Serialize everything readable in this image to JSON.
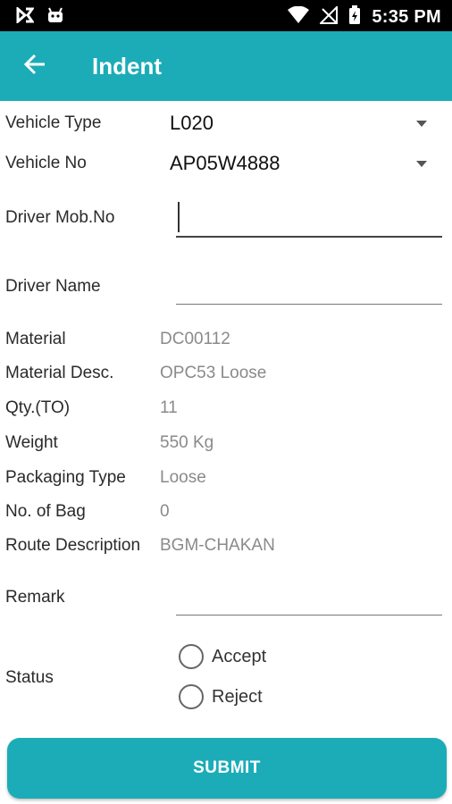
{
  "status_bar": {
    "time": "5:35 PM",
    "left_icons": [
      "notification-app-icon",
      "android-icon"
    ],
    "right_icons": [
      "wifi-icon",
      "no-signal-icon",
      "battery-charging-icon"
    ]
  },
  "app_bar": {
    "title": "Indent",
    "back_icon": "arrow-back-icon",
    "color": "#1bacb8"
  },
  "form": {
    "vehicle_type": {
      "label": "Vehicle Type",
      "value": "L020"
    },
    "vehicle_no": {
      "label": "Vehicle No",
      "value": "AP05W4888"
    },
    "driver_mob_no": {
      "label": "Driver Mob.No",
      "value": "",
      "placeholder": ""
    },
    "driver_name": {
      "label": "Driver Name",
      "value": "",
      "placeholder": ""
    },
    "details": [
      {
        "label": "Material",
        "value": "DC00112"
      },
      {
        "label": "Material Desc.",
        "value": "OPC53 Loose"
      },
      {
        "label": "Qty.(TO)",
        "value": "11"
      },
      {
        "label": "Weight",
        "value": "550 Kg"
      },
      {
        "label": "Packaging Type",
        "value": "Loose"
      },
      {
        "label": "No. of Bag",
        "value": "0"
      },
      {
        "label": "Route Description",
        "value": "BGM-CHAKAN"
      }
    ],
    "remark": {
      "label": "Remark",
      "value": "",
      "placeholder": ""
    },
    "status": {
      "label": "Status",
      "options": [
        "Accept",
        "Reject"
      ],
      "selected": null
    }
  },
  "submit_label": "SUBMIT"
}
